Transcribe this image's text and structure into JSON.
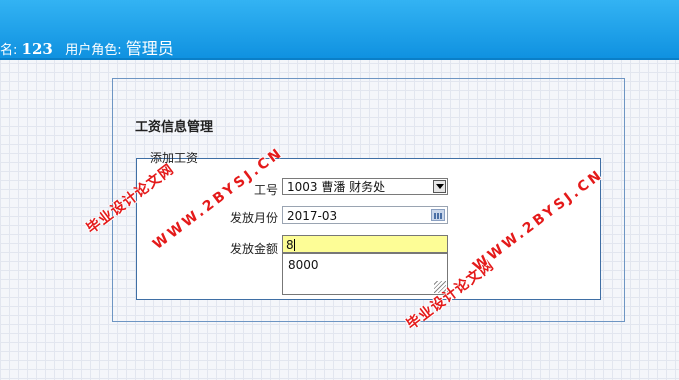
{
  "header": {
    "user_prefix": "名:",
    "user_name": "123",
    "role_prefix": "用户角色:",
    "role_name": "管理员"
  },
  "panel": {
    "title": "工资信息管理",
    "legend": "添加工资"
  },
  "form": {
    "employee_label": "工号",
    "employee_value": "1003 曹潘 财务处",
    "month_label": "发放月份",
    "month_value": "2017-03",
    "amount_label": "发放金额",
    "amount_value": "8",
    "suggestion": "8000"
  },
  "watermarks": {
    "site": "WWW.2BYSJ.CN",
    "name": "毕业设计论文网"
  },
  "colors": {
    "header": "#1a9de8",
    "amount_bg": "#fdfd96",
    "watermark": "#e41a1a"
  }
}
